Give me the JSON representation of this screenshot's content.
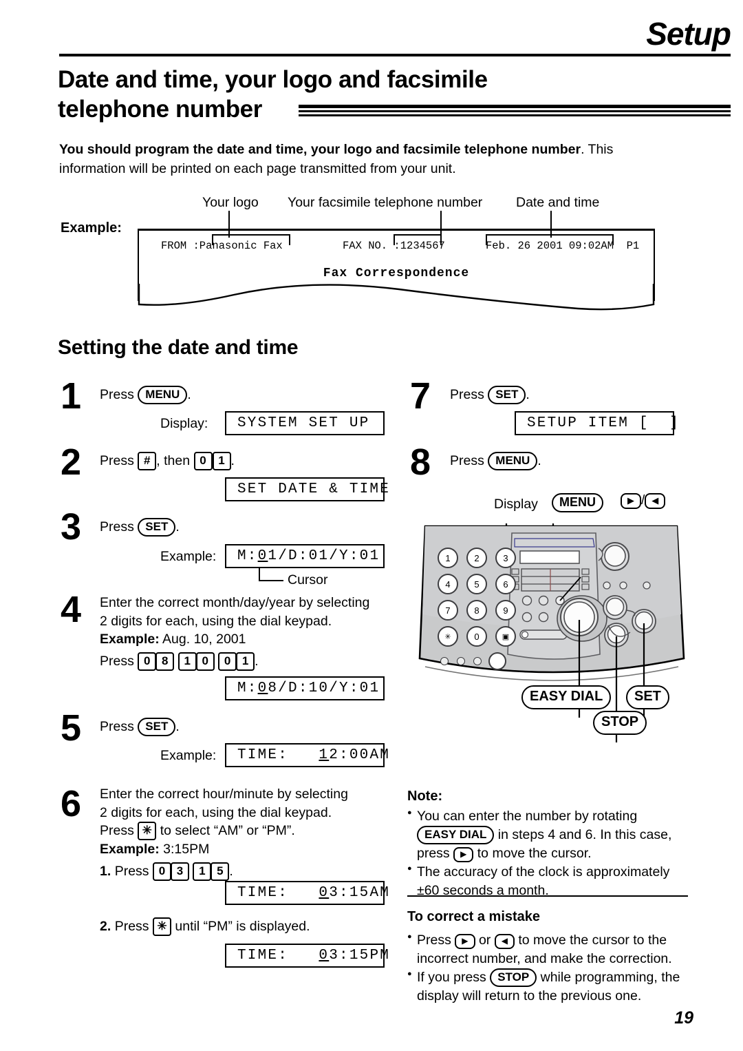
{
  "header": {
    "chapter_title": "Setup"
  },
  "section": {
    "title_line1": "Date and time, your logo and facsimile",
    "title_line2": "telephone number"
  },
  "intro": {
    "bold_part": "You should program the date and time, your logo and facsimile telephone number",
    "rest": ". This information will be printed on each page transmitted from your unit."
  },
  "example_block": {
    "example_label": "Example:",
    "callouts": {
      "logo": "Your logo",
      "fax_number": "Your facsimile telephone number",
      "date_time": "Date and time"
    },
    "fax_header": {
      "from": "FROM :Panasonic Fax",
      "fax_no": "FAX NO. :1234567",
      "date_time": "Feb. 26 2001 09:02AM  P1"
    },
    "body_text": "Fax Correspondence"
  },
  "subsection": {
    "title": "Setting the date and time"
  },
  "steps": [
    {
      "num": "1",
      "press_label": "Press",
      "key": "MENU",
      "period": ".",
      "display_label": "Display:",
      "lcd": "SYSTEM SET UP"
    },
    {
      "num": "2",
      "press_label": "Press",
      "key_hash": "#",
      "then_label": ", then",
      "keys": [
        "0",
        "1"
      ],
      "period": ".",
      "lcd": "SET DATE & TIME"
    },
    {
      "num": "3",
      "press_label": "Press",
      "key": "SET",
      "period": ".",
      "example_label": "Example:",
      "lcd_pre": "M:",
      "lcd_cursor": "0",
      "lcd_post": "1/D:01/Y:01",
      "cursor_callout": "Cursor"
    },
    {
      "num": "4",
      "line1": "Enter the correct month/day/year by selecting",
      "line2": "2 digits for each, using the dial keypad.",
      "example_bold": "Example:",
      "example_value": "Aug. 10, 2001",
      "press_label": "Press",
      "keys": [
        "0",
        "8",
        "1",
        "0",
        "0",
        "1"
      ],
      "period": ".",
      "lcd_pre": "M:",
      "lcd_cursor": "0",
      "lcd_post": "8/D:10/Y:01"
    },
    {
      "num": "5",
      "press_label": "Press",
      "key": "SET",
      "period": ".",
      "example_label": "Example:",
      "lcd_pre": "TIME:   ",
      "lcd_cursor": "1",
      "lcd_post": "2:00AM"
    },
    {
      "num": "6",
      "line1": "Enter the correct hour/minute by selecting",
      "line2": "2 digits for each, using the dial keypad.",
      "line3_pre": "Press",
      "key_star": "✳",
      "line3_post": "to select “AM” or “PM”.",
      "example_bold": "Example:",
      "example_value": "3:15PM",
      "sub1_num": "1.",
      "sub1_press": "Press",
      "sub1_keys": [
        "0",
        "3",
        "1",
        "5"
      ],
      "sub1_period": ".",
      "lcd1_pre": "TIME:   ",
      "lcd1_cursor": "0",
      "lcd1_post": "3:15AM",
      "sub2_num": "2.",
      "sub2_press": "Press",
      "sub2_post": "until “PM” is displayed.",
      "lcd2_pre": "TIME:   ",
      "lcd2_cursor": "0",
      "lcd2_post": "3:15PM"
    },
    {
      "num": "7",
      "press_label": "Press",
      "key": "SET",
      "period": ".",
      "lcd": "SETUP ITEM [  ]"
    },
    {
      "num": "8",
      "press_label": "Press",
      "key": "MENU",
      "period": "."
    }
  ],
  "machine_callouts": {
    "display": "Display",
    "menu": "MENU",
    "arrow_right": "▶",
    "slash": "/",
    "arrow_left": "◀",
    "easy_dial": "EASY DIAL",
    "set": "SET",
    "stop": "STOP"
  },
  "keypad": {
    "rows": [
      [
        "1",
        "2",
        "3"
      ],
      [
        "4",
        "5",
        "6"
      ],
      [
        "7",
        "8",
        "9"
      ],
      [
        "✳",
        "0",
        "▣"
      ]
    ]
  },
  "note": {
    "heading": "Note:",
    "b1_part1": "You can enter the number by rotating",
    "b1_key": "EASY DIAL",
    "b1_part2": "in steps 4 and 6. In this case,",
    "b1_part3_pre": "press",
    "b1_arrow": "▶",
    "b1_part3_post": "to move the cursor.",
    "b2_part1": "The accuracy of the clock is approximately",
    "b2_part2": "±60 seconds a month."
  },
  "correct_mistake": {
    "heading": "To correct a mistake",
    "b1_pre": "Press",
    "b1_arrow_r": "▶",
    "b1_or": "or",
    "b1_arrow_l": "◀",
    "b1_post": "to move the cursor to the",
    "b1_line2": "incorrect number, and make the correction.",
    "b2_pre": "If you press",
    "b2_key": "STOP",
    "b2_post": "while programming, the",
    "b2_line2": "display will return to the previous one."
  },
  "page": {
    "number": "19"
  },
  "colors": {
    "ink": "#000000",
    "machine_body": "#c9cacb",
    "machine_body_light": "#d7d8d9",
    "paper": "#ffffff"
  }
}
